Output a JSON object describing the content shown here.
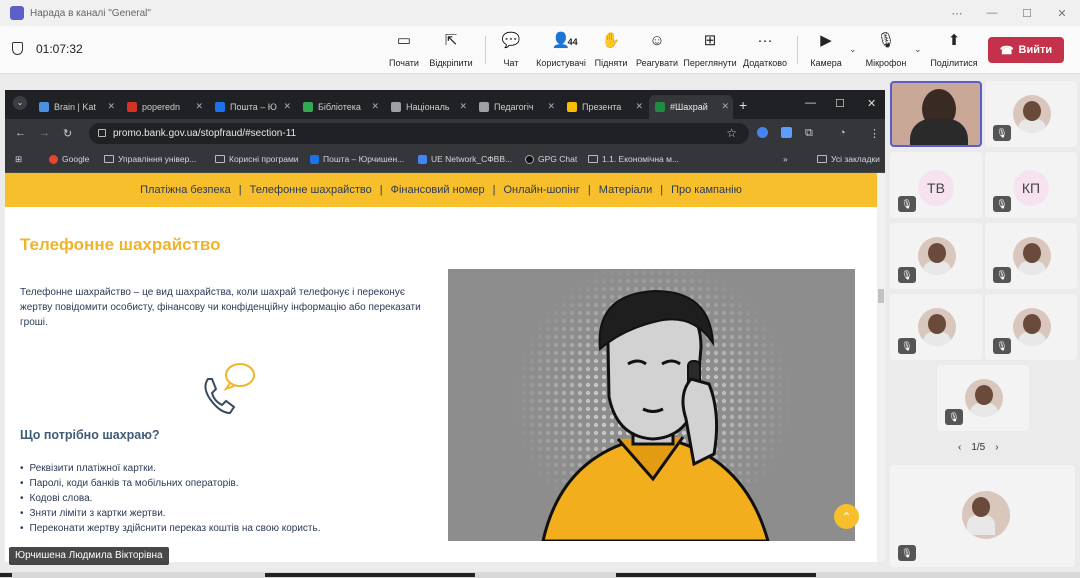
{
  "window": {
    "title": "Нарада в каналі \"General\""
  },
  "meeting": {
    "timer": "01:07:32",
    "buttons": [
      {
        "id": "start",
        "label": "Почати",
        "icon": "▭"
      },
      {
        "id": "unpin",
        "label": "Відкріпити",
        "icon": "⇱"
      },
      {
        "id": "chat",
        "label": "Чат",
        "icon": "💬"
      },
      {
        "id": "people",
        "label": "Користувачі",
        "icon": "👤",
        "count": "44"
      },
      {
        "id": "raise",
        "label": "Підняти",
        "icon": "✋"
      },
      {
        "id": "react",
        "label": "Реагувати",
        "icon": "☺"
      },
      {
        "id": "view",
        "label": "Переглянути",
        "icon": "⊞"
      },
      {
        "id": "more",
        "label": "Додатково",
        "icon": "···"
      },
      {
        "id": "camera",
        "label": "Камера",
        "icon": "▶"
      },
      {
        "id": "mic",
        "label": "Мікрофон",
        "icon": "🎙"
      },
      {
        "id": "share",
        "label": "Поділитися",
        "icon": "⬆"
      }
    ],
    "leave_label": "Вийти",
    "presenter_name": "Юрчишена Людмила Вікторівна",
    "pager": "1/5"
  },
  "browser": {
    "tabs": [
      {
        "label": "Brain | Kat",
        "color": "#4a90e2"
      },
      {
        "label": "poperedn",
        "color": "#d93025"
      },
      {
        "label": "Пошта – Ю",
        "color": "#1a73e8"
      },
      {
        "label": "Бібліотека",
        "color": "#34a853"
      },
      {
        "label": "Національ",
        "color": "#9aa0a6"
      },
      {
        "label": "Педагогіч",
        "color": "#9aa0a6"
      },
      {
        "label": "Презента",
        "color": "#fbbc04"
      },
      {
        "label": "#Шахрай",
        "color": "#1e8e3e"
      }
    ],
    "url": "promo.bank.gov.ua/stopfraud/#section-11",
    "bookmarks": [
      {
        "label": "Google",
        "type": "dot",
        "color": "#ea4335"
      },
      {
        "label": "Управління універ...",
        "type": "folder"
      },
      {
        "label": "Корисні програми",
        "type": "folder"
      },
      {
        "label": "Пошта – Юрчишен...",
        "type": "dot",
        "color": "#1a73e8"
      },
      {
        "label": "UE Network_СФВВ...",
        "type": "dot",
        "color": "#4285f4"
      },
      {
        "label": "GPG Chat",
        "type": "dot",
        "color": "#222"
      },
      {
        "label": "1.1. Економічна м...",
        "type": "folder"
      },
      {
        "label": "Усі закладки",
        "type": "folder"
      }
    ]
  },
  "site": {
    "nav": [
      "Платіжна безпека",
      "Телефонне шахрайство",
      "Фінансовий номер",
      "Онлайн-шопінг",
      "Матеріали",
      "Про кампанію"
    ],
    "heading": "Телефонне шахрайство",
    "paragraph": "Телефонне шахрайство – це вид шахрайства, коли шахрай телефонує і переконує жертву повідомити особисту, фінансову чи конфіденційну інформацію або переказати гроші.",
    "subheading": "Що потрібно шахраю?",
    "list": [
      "Реквізити платіжної картки.",
      "Паролі, коди банків та мобільних операторів.",
      "Кодові слова.",
      "Зняти ліміти з картки жертви.",
      "Переконати жертву здійснити переказ коштів на свою користь."
    ]
  },
  "participants": [
    {
      "type": "video"
    },
    {
      "type": "photo",
      "muted": true
    },
    {
      "type": "initials",
      "initials": "ТВ",
      "muted": true
    },
    {
      "type": "initials",
      "initials": "КП",
      "muted": true
    },
    {
      "type": "photo",
      "muted": true
    },
    {
      "type": "photo",
      "muted": true
    },
    {
      "type": "photo",
      "muted": true
    },
    {
      "type": "photo",
      "muted": true
    },
    {
      "type": "photo",
      "muted": true
    }
  ],
  "self_tile": {
    "muted": true
  }
}
